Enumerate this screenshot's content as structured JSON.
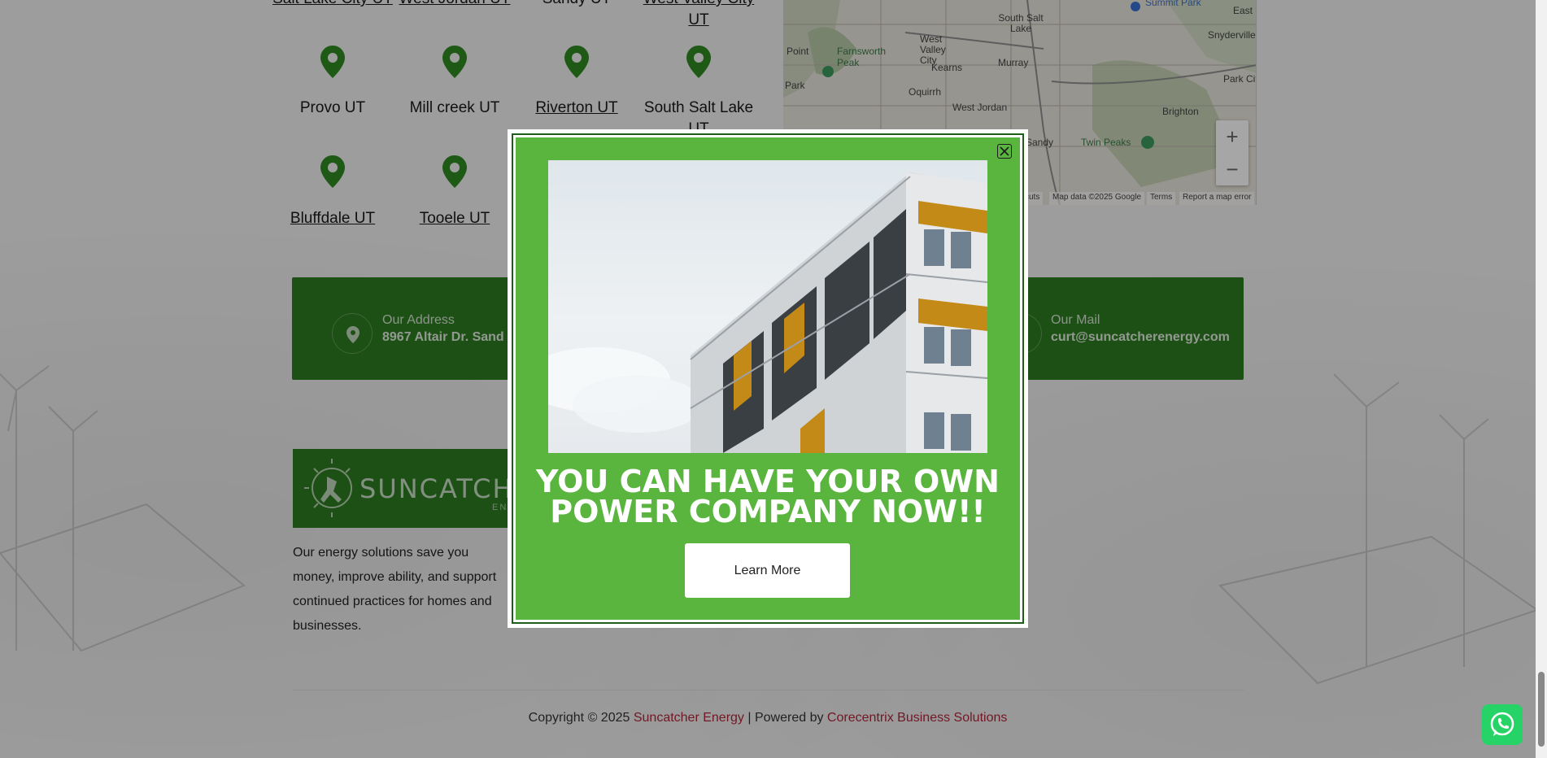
{
  "locations": {
    "row0": [
      "Salt Lake City UT",
      "West Jordan UT",
      "Sandy UT",
      "West Valley City UT"
    ],
    "row1": [
      "Provo UT",
      "Mill creek UT",
      "Riverton UT",
      "South Salt Lake UT"
    ],
    "row2": [
      "Bluffdale UT",
      "Tooele UT"
    ]
  },
  "map": {
    "labels": {
      "south_salt_lake": "South Salt Lake",
      "west_valley_city": "West Valley City",
      "farnsworth_peak": "Farnsworth Peak",
      "kearns": "Kearns",
      "murray": "Murray",
      "oquirrh": "Oquirrh",
      "west_jordan": "West Jordan",
      "brighton": "Brighton",
      "twin_peaks": "Twin Peaks",
      "snyderville": "Snyderville",
      "park_city": "Park Cit",
      "east": "East",
      "point": "Point",
      "park": "Park",
      "sandy": "Sandy",
      "summit_park": "Summit Park"
    },
    "footer": {
      "shortcuts": "cuts",
      "map_data": "Map data ©2025 Google",
      "terms": "Terms",
      "report": "Report a map error"
    },
    "zoom_in": "+",
    "zoom_out": "−"
  },
  "contact": {
    "address_label": "Our Address",
    "address_value": "8967 Altair Dr. Sand",
    "mail_label": "Our Mail",
    "mail_value": "curt@suncatcherenergy.com"
  },
  "footer": {
    "logo_text": "SUNCATCHER",
    "logo_sub": "ENERG",
    "about": "Our energy solutions save you money, improve ability, and support continued practices for homes and businesses.",
    "copyright_prefix": "Copyright © 2025",
    "brand": "Suncatcher Energy",
    "separator": "| Powered by",
    "powered_by": "Corecentrix Business Solutions"
  },
  "popup": {
    "headline": "YOU CAN HAVE YOUR OWN POWER COMPANY NOW!!",
    "button_label": "Learn More"
  },
  "colors": {
    "brand_green": "#2c7b1f",
    "popup_green": "#5ab53f",
    "accent_red": "#b0263a",
    "whatsapp_green": "#25d366"
  }
}
